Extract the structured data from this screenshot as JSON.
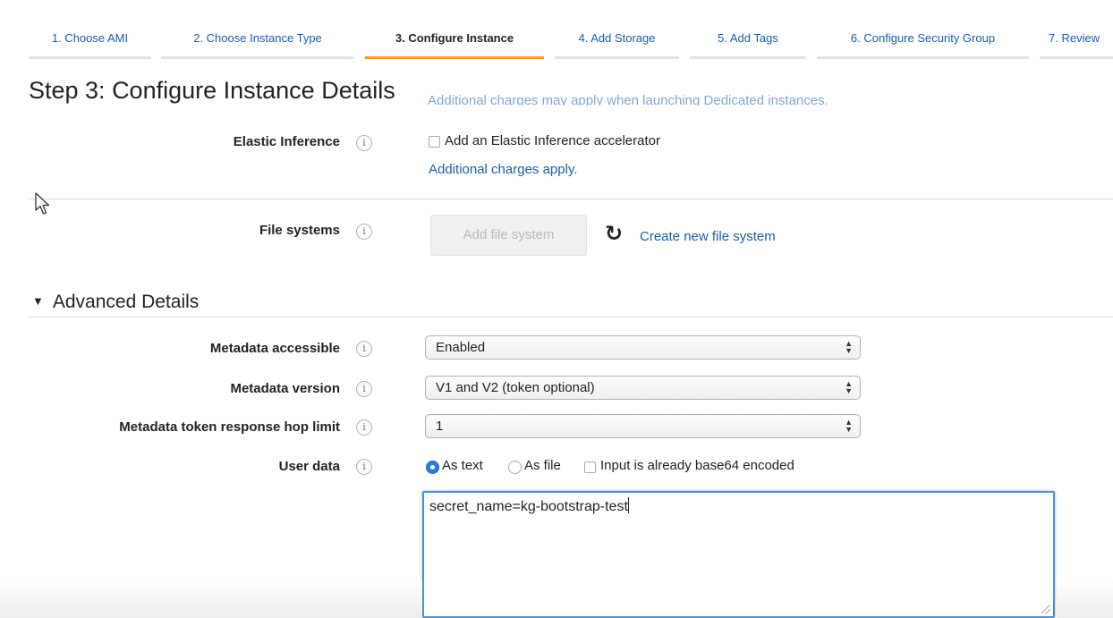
{
  "wizard": {
    "steps": [
      {
        "label": "1. Choose AMI"
      },
      {
        "label": "2. Choose Instance Type"
      },
      {
        "label": "3. Configure Instance"
      },
      {
        "label": "4. Add Storage"
      },
      {
        "label": "5. Add Tags"
      },
      {
        "label": "6. Configure Security Group"
      },
      {
        "label": "7. Review"
      }
    ],
    "active_step": 3
  },
  "page_title": "Step 3: Configure Instance Details",
  "faded_note": "Additional charges may apply when launching Dedicated instances.",
  "elastic_inference": {
    "label": "Elastic Inference",
    "checkbox_label": "Add an Elastic Inference accelerator",
    "checked": false,
    "link": "Additional charges apply."
  },
  "file_systems": {
    "label": "File systems",
    "button": "Add file system",
    "refresh_icon": "refresh-icon",
    "create_link": "Create new file system"
  },
  "advanced": {
    "title": "Advanced Details",
    "metadata_accessible": {
      "label": "Metadata accessible",
      "value": "Enabled"
    },
    "metadata_version": {
      "label": "Metadata version",
      "value": "V1 and V2 (token optional)"
    },
    "hop_limit": {
      "label": "Metadata token response hop limit",
      "value": "1"
    },
    "user_data": {
      "label": "User data",
      "as_text": "As text",
      "as_file": "As file",
      "base64_label": "Input is already base64 encoded",
      "selected": "As text",
      "base64_checked": false,
      "value": "secret_name=kg-bootstrap-test"
    }
  },
  "info_icon": "i",
  "colors": {
    "link": "#1a5ea8",
    "active_tab_underline": "#f29f2c",
    "radio_selected": "#2b7bd8",
    "focus_border": "#4b8fd6"
  }
}
